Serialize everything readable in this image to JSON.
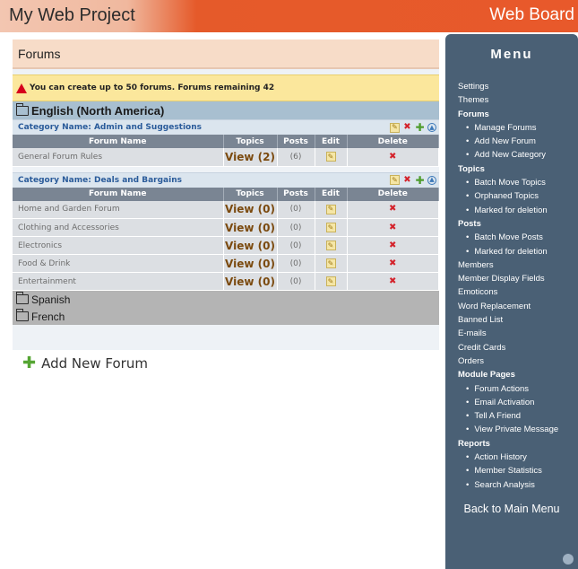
{
  "header": {
    "project": "My Web Project",
    "board": "Web Board"
  },
  "main": {
    "title": "Forums",
    "alert": "You can create up to 50 forums. Forums remaining 42",
    "table_headers": {
      "name": "Forum Name",
      "topics": "Topics",
      "posts": "Posts",
      "edit": "Edit",
      "delete": "Delete"
    },
    "languages": {
      "english": "English (North America)",
      "spanish": "Spanish",
      "french": "French"
    },
    "categories": [
      {
        "label": "Category Name: Admin and Suggestions",
        "forums": [
          {
            "name": "General Forum Rules",
            "view": "View (2)",
            "posts": "(6)"
          }
        ]
      },
      {
        "label": "Category Name: Deals and Bargains",
        "forums": [
          {
            "name": "Home and Garden Forum",
            "view": "View (0)",
            "posts": "(0)"
          },
          {
            "name": "Clothing and Accessories",
            "view": "View (0)",
            "posts": "(0)"
          },
          {
            "name": "Electronics",
            "view": "View (0)",
            "posts": "(0)"
          },
          {
            "name": "Food & Drink",
            "view": "View (0)",
            "posts": "(0)"
          },
          {
            "name": "Entertainment",
            "view": "View (0)",
            "posts": "(0)"
          }
        ]
      }
    ],
    "add_new_forum": "Add New Forum"
  },
  "menu": {
    "title": "Menu",
    "items": [
      {
        "label": "Settings",
        "type": "item"
      },
      {
        "label": "Themes",
        "type": "item"
      },
      {
        "label": "Forums",
        "type": "sec"
      },
      {
        "label": "Manage Forums",
        "type": "sub"
      },
      {
        "label": "Add New Forum",
        "type": "sub"
      },
      {
        "label": "Add New Category",
        "type": "sub"
      },
      {
        "label": "Topics",
        "type": "sec"
      },
      {
        "label": "Batch Move Topics",
        "type": "sub"
      },
      {
        "label": "Orphaned Topics",
        "type": "sub"
      },
      {
        "label": "Marked for deletion",
        "type": "sub"
      },
      {
        "label": "Posts",
        "type": "sec"
      },
      {
        "label": "Batch Move Posts",
        "type": "sub"
      },
      {
        "label": "Marked for deletion",
        "type": "sub"
      },
      {
        "label": "Members",
        "type": "item"
      },
      {
        "label": "Member Display Fields",
        "type": "item"
      },
      {
        "label": "Emoticons",
        "type": "item"
      },
      {
        "label": "Word Replacement",
        "type": "item"
      },
      {
        "label": "Banned List",
        "type": "item"
      },
      {
        "label": "E-mails",
        "type": "item"
      },
      {
        "label": "Credit Cards",
        "type": "item"
      },
      {
        "label": "Orders",
        "type": "item"
      },
      {
        "label": "Module Pages",
        "type": "sec"
      },
      {
        "label": "Forum Actions",
        "type": "sub"
      },
      {
        "label": "Email Activation",
        "type": "sub"
      },
      {
        "label": "Tell A Friend",
        "type": "sub"
      },
      {
        "label": "View Private Message",
        "type": "sub"
      },
      {
        "label": "Reports",
        "type": "sec"
      },
      {
        "label": "Action History",
        "type": "sub"
      },
      {
        "label": "Member Statistics",
        "type": "sub"
      },
      {
        "label": "Search Analysis",
        "type": "sub"
      }
    ],
    "back": "Back to Main Menu"
  }
}
